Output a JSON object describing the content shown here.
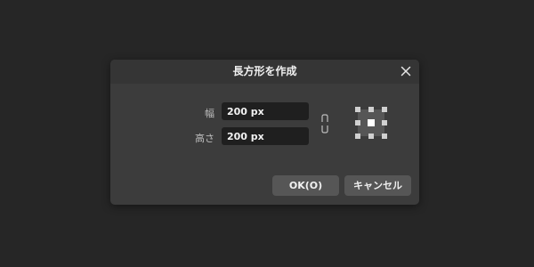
{
  "dialog": {
    "title": "長方形を作成",
    "close_icon": "close-icon",
    "width_label": "幅",
    "width_value": "200 px",
    "height_label": "高さ",
    "height_value": "200 px",
    "link_icon": "chain-link-icon",
    "anchor_icon": "anchor-grid-icon",
    "ok_label": "OK(O)",
    "cancel_label": "キャンセル"
  }
}
